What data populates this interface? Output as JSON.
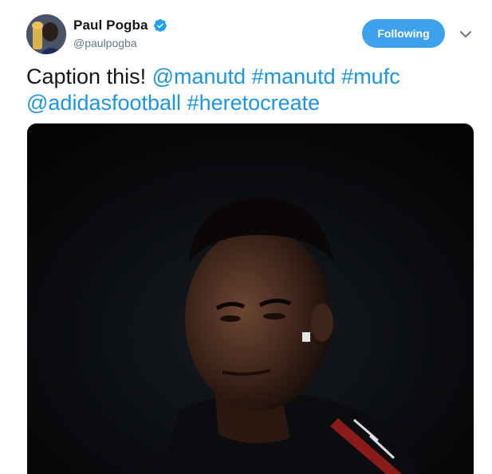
{
  "tweet": {
    "author": {
      "display_name": "Paul Pogba",
      "handle": "@paulpogba",
      "verified": true,
      "avatar_icon": "avatar-photo"
    },
    "follow_button_label": "Following",
    "menu_icon": "chevron-down-icon",
    "text": {
      "prefix": "Caption this! ",
      "entities": [
        "@manutd",
        "#manutd",
        "#mufc",
        "@adidasfootball",
        "#heretocreate"
      ]
    },
    "media_alt": "photo"
  },
  "colors": {
    "link": "#1b95e0",
    "follow_button": "#3ea1ec",
    "verified_badge": "#1da1f2",
    "handle_text": "#657786"
  }
}
